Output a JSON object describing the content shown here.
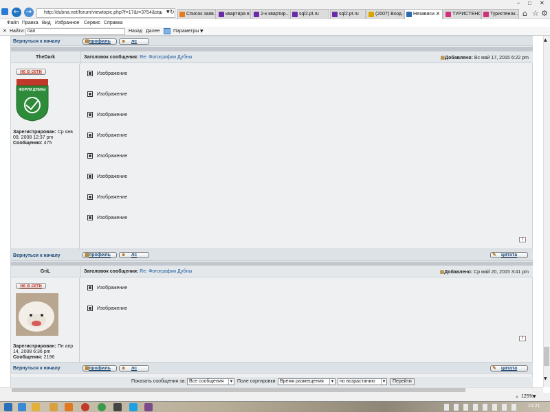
{
  "browser": {
    "url": "http://dubna.net/forum/viewtopic.php?f=17&t=3754&sta",
    "tabs": [
      {
        "label": "Список заяв...",
        "color": "#e87b1e"
      },
      {
        "label": "квартира в ...",
        "color": "#6b2aa8"
      },
      {
        "label": "2-к квартир...",
        "color": "#6b2aa8"
      },
      {
        "label": "sql2.pt.ru",
        "color": "#6b2aa8"
      },
      {
        "label": "sql2.pt.ru",
        "color": "#6b2aa8"
      },
      {
        "label": "(2007) Вход...",
        "color": "#d9a400"
      },
      {
        "label": "Независи...",
        "color": "#2b6cb0",
        "active": true
      },
      {
        "label": "ТУРИСТЕНО...",
        "color": "#d0307a"
      },
      {
        "label": "Туристенок...",
        "color": "#d0307a"
      }
    ],
    "menu": [
      "Файл",
      "Правка",
      "Вид",
      "Избранное",
      "Сервис",
      "Справка"
    ],
    "find": {
      "label": "Найти:",
      "value": "пап",
      "back": "Назад",
      "forward": "Далее",
      "params": "Параметры"
    },
    "zoom": "125%",
    "clock": "10:21"
  },
  "forum": {
    "back_to_top": "Вернуться к началу",
    "btn_profile": "профиль",
    "btn_pm": "лс",
    "btn_quote": "цитата",
    "subject_label": "Заголовок сообщения:",
    "added_label": "Добавлено:",
    "registered_label": "Зарегистрирован:",
    "posts_label": "Сообщения:",
    "offline": "не в сети",
    "image_text": "Изображение",
    "posts": [
      {
        "author": "TheDark",
        "subject": "Re: Фотографии Дубны",
        "date": "Вс май 17, 2015 6:22 pm",
        "registered": "Ср янв 09, 2008 12:37 pm",
        "count": "475",
        "images": 8,
        "avatar_text": "ФОРУМ ДУБНЫ"
      },
      {
        "author": "GriL",
        "subject": "Re: Фотографии Дубны",
        "date": "Ср май 20, 2015 3:41 pm",
        "registered": "Пн апр 14, 2008 6:36 pm",
        "count": "2196",
        "images": 2
      }
    ],
    "sort": {
      "show_label": "Показать сообщения за:",
      "show_value": "Все сообщения",
      "sort_label": "Поле сортировки",
      "sort_value": "Время размещения",
      "order_value": "по возрастанию",
      "go": "Перейти"
    }
  }
}
